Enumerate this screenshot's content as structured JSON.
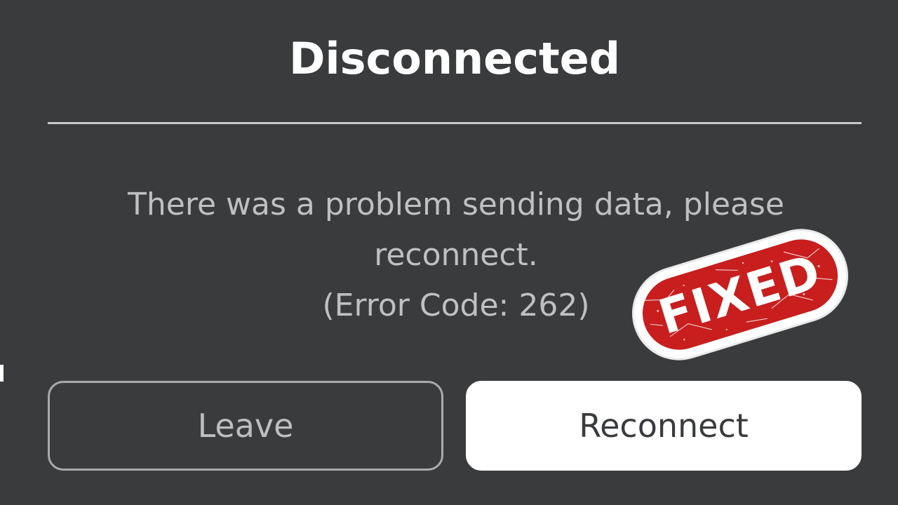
{
  "dialog": {
    "title": "Disconnected",
    "message_line1": "There was a problem sending data, please",
    "message_line2": "reconnect.",
    "error_code": "(Error Code: 262)"
  },
  "buttons": {
    "leave_label": "Leave",
    "reconnect_label": "Reconnect"
  },
  "overlay": {
    "stamp_text": "FIXED"
  },
  "colors": {
    "background": "#393b3d",
    "stamp_red": "#c81e1e",
    "primary_button": "#ffffff"
  }
}
